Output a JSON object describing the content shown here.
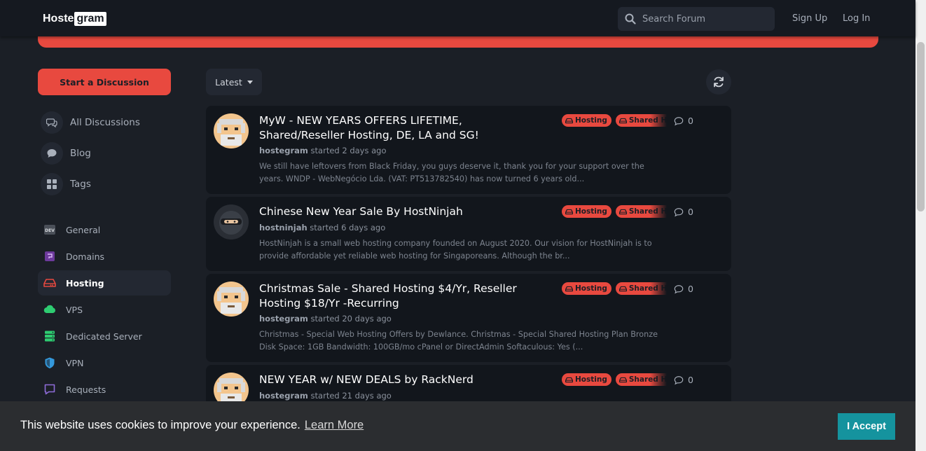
{
  "header": {
    "logo_left": "Hoste",
    "logo_right": "gram",
    "search_placeholder": "Search Forum",
    "signup": "Sign Up",
    "login": "Log In"
  },
  "sidebar": {
    "start_button": "Start a Discussion",
    "nav": [
      {
        "label": "All Discussions",
        "icon": "comments-icon"
      },
      {
        "label": "Blog",
        "icon": "comment-icon"
      },
      {
        "label": "Tags",
        "icon": "th-large-icon"
      }
    ],
    "tags": [
      {
        "label": "General",
        "icon": "dev-icon",
        "color": "#9aa1ac"
      },
      {
        "label": "Domains",
        "icon": "domain-icon",
        "color": "#9b59d0"
      },
      {
        "label": "Hosting",
        "icon": "hdd-icon",
        "color": "#e8493f",
        "active": true
      },
      {
        "label": "VPS",
        "icon": "cloud-icon",
        "color": "#2ecc71"
      },
      {
        "label": "Dedicated Server",
        "icon": "server-icon",
        "color": "#2ecc71"
      },
      {
        "label": "VPN",
        "icon": "shield-icon",
        "color": "#3498db"
      },
      {
        "label": "Requests",
        "icon": "message-icon",
        "color": "#8e6bd8"
      }
    ]
  },
  "toolbar": {
    "sort_label": "Latest"
  },
  "badges": {
    "hosting": "Hosting",
    "shared": "Shared Hosting"
  },
  "discussions": [
    {
      "title": "MyW - NEW YEARS OFFERS LIFETIME, Shared/Reseller Hosting, DE, LA and SG!",
      "author": "hostegram",
      "started": "started 2 days ago",
      "excerpt": "We still have leftovers from Black Friday, you guys deserve it, thank you for your support over the years. WNDP - WebNegócio Lda. (VAT: PT513782540) has now turned 6 years old...",
      "replies": "0"
    },
    {
      "title": "Chinese New Year Sale By HostNinjah",
      "author": "hostninjah",
      "started": "started 6 days ago",
      "excerpt": "HostNinjah is a small web hosting company founded on August 2020. Our vision for HostNinjah is to provide affordable yet reliable web hosting for Singaporeans. Although the br...",
      "replies": "0"
    },
    {
      "title": "Christmas Sale - Shared Hosting $4/Yr, Reseller Hosting $18/Yr -Recurring",
      "author": "hostegram",
      "started": "started 20 days ago",
      "excerpt": "Christmas - Special Web Hosting Offers by Dewlance. Christmas - Special Shared Hosting Plan Bronze Disk Space: 1GB Bandwidth: 100GB/mo cPanel or DirectAdmin Softaculous: Yes (...",
      "replies": "0"
    },
    {
      "title": "NEW YEAR w/ NEW DEALS by RackNerd",
      "author": "hostegram",
      "started": "started 21 days ago",
      "excerpt": "",
      "replies": "0"
    }
  ],
  "cookie": {
    "message": "This website uses cookies to improve your experience.",
    "learn_more": "Learn More",
    "accept": "I Accept"
  },
  "colors": {
    "accent": "#e8493f",
    "background": "#1b1f26",
    "card": "#12161c",
    "accept": "#15939e"
  }
}
